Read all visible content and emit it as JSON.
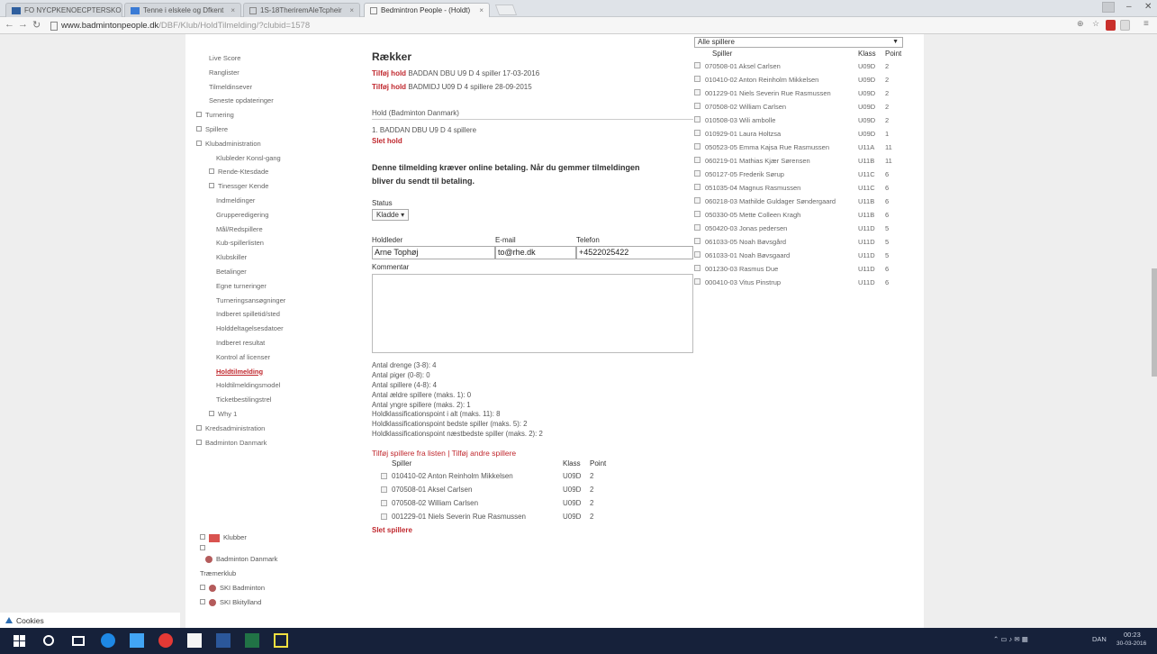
{
  "browser": {
    "tabs": [
      {
        "label": "FO NYCPKENOECPTERSKO"
      },
      {
        "label": "Tenne i elskele og Dfkent"
      },
      {
        "label": "1S-18TheriremAleTcpheir"
      },
      {
        "label": "Bedmintron People - (Holdt)"
      }
    ],
    "url_host": "www.badmintonpeople.dk",
    "url_path": "/DBF/Klub/HoldTilmelding/?clubid=1578"
  },
  "sidebar": {
    "items": [
      {
        "label": "Live Score",
        "level": 2
      },
      {
        "label": "Ranglister",
        "level": 2
      },
      {
        "label": "Tilmeldinsever",
        "level": 2
      },
      {
        "label": "Seneste opdateringer",
        "level": 2
      },
      {
        "label": "Turnering",
        "level": 1,
        "exp": true
      },
      {
        "label": "Spillere",
        "level": 1,
        "exp": true
      },
      {
        "label": "Klubadministration",
        "level": 1,
        "exp": true
      },
      {
        "label": "Klubleder Konsl-gang",
        "level": 3
      },
      {
        "label": "Rende-Ktesdade",
        "level": 2,
        "exp": true
      },
      {
        "label": "Tinessger Kende",
        "level": 2,
        "exp": true
      },
      {
        "label": "Indmeldinger",
        "level": 3
      },
      {
        "label": "Grupperedigering",
        "level": 3
      },
      {
        "label": "Mål/Redspillere",
        "level": 3
      },
      {
        "label": "Kub-spillerlisten",
        "level": 3
      },
      {
        "label": "Klubskiller",
        "level": 3
      },
      {
        "label": "Betalinger",
        "level": 3
      },
      {
        "label": "Egne turneringer",
        "level": 3
      },
      {
        "label": "Turneringsansøgninger",
        "level": 3
      },
      {
        "label": "Indberet spilletid/sted",
        "level": 3
      },
      {
        "label": "Holddeltagelsesdatoer",
        "level": 3
      },
      {
        "label": "Indberet resultat",
        "level": 3
      },
      {
        "label": "Kontrol af licenser",
        "level": 3
      },
      {
        "label": "Holdtilmelding",
        "level": 3,
        "active": true
      },
      {
        "label": "Holdtilmeldingsmodel",
        "level": 3
      },
      {
        "label": "Ticketbestilingstrel",
        "level": 3
      },
      {
        "label": "Why 1",
        "level": 2,
        "exp": true
      },
      {
        "label": "Kredsadministration",
        "level": 1,
        "exp": true
      },
      {
        "label": "Badminton Danmark",
        "level": 1,
        "exp": true
      }
    ],
    "klubber": {
      "title": "Klubber",
      "org": "Badminton Danmark",
      "kreds": "Træmerklub",
      "clubs": [
        "SKI Badminton",
        "SKI Bkitylland"
      ]
    }
  },
  "main": {
    "heading": "Rækker",
    "added": [
      {
        "prefix": "Tilføj hold",
        "text": "BADDAN DBU U9 D 4 spiller 17-03-2016"
      },
      {
        "prefix": "Tilføj hold",
        "text": "BADMIDJ U09 D 4 spillere      28-09-2015"
      }
    ],
    "hold_header": "Hold (Badminton Danmark)",
    "hold_line": "1. BADDAN DBU U9 D 4 spillere",
    "slet_hold": "Slet hold",
    "notice": "Denne tilmelding kræver online betaling. Når du gemmer tilmeldingen bliver du sendt til betaling.",
    "status_label": "Status",
    "status_value": "Kladde",
    "field_labels": {
      "holdleder": "Holdleder",
      "email": "E-mail",
      "telefon": "Telefon"
    },
    "fields": {
      "holdleder": "Arne Tophøj",
      "email": "to@rhe.dk",
      "telefon": "+4522025422"
    },
    "kommentar_label": "Kommentar",
    "stats": [
      "Antal drenge (3-8): 4",
      "Antal piger (0-8): 0",
      "Antal spillere (4-8): 4",
      "Antal ældre spillere (maks. 1): 0",
      "Antal yngre spillere (maks. 2): 1",
      "Holdklassificationspoint i alt (maks. 11): 8",
      "Holdklassificationspoint bedste spiller (maks. 5): 2",
      "Holdklassificationspoint næstbedste spiller (maks. 2): 2"
    ],
    "add_players": {
      "link1": "Tilføj spillere fra listen",
      "sep": " | ",
      "link2": "Tilføj andre spillere"
    },
    "player_cols": {
      "spiller": "Spiller",
      "klasse": "Klass",
      "point": "Point"
    },
    "players": [
      {
        "name": "010410-02 Anton Reinholm Mikkelsen",
        "klasse": "U09D",
        "point": "2"
      },
      {
        "name": "070508-01 Aksel Carlsen",
        "klasse": "U09D",
        "point": "2"
      },
      {
        "name": "070508-02 William Carlsen",
        "klasse": "U09D",
        "point": "2"
      },
      {
        "name": "001229-01 Niels Severin Rue Rasmussen",
        "klasse": "U09D",
        "point": "2"
      }
    ],
    "slet_spillere": "Slet spillere"
  },
  "right": {
    "filter": "Alle spillere",
    "cols": {
      "spiller": "Spiller",
      "klasse": "Klass",
      "point": "Point"
    },
    "rows": [
      {
        "name": "070508-01 Aksel Carlsen",
        "klasse": "U09D",
        "point": "2"
      },
      {
        "name": "010410-02 Anton Reinholm Mikkelsen",
        "klasse": "U09D",
        "point": "2"
      },
      {
        "name": "001229-01 Niels Severin Rue Rasmussen",
        "klasse": "U09D",
        "point": "2"
      },
      {
        "name": "070508-02 William Carlsen",
        "klasse": "U09D",
        "point": "2"
      },
      {
        "name": "010508-03 Wili ambolle",
        "klasse": "U09D",
        "point": "2"
      },
      {
        "name": "010929-01 Laura Holtzsa",
        "klasse": "U09D",
        "point": "1"
      },
      {
        "name": "050523-05 Emma Kajsa Rue Rasmussen",
        "klasse": "U11A",
        "point": "11"
      },
      {
        "name": "060219-01 Mathias Kjær Sørensen",
        "klasse": "U11B",
        "point": "11"
      },
      {
        "name": "050127-05 Frederik Sørup",
        "klasse": "U11C",
        "point": "6"
      },
      {
        "name": "051035-04 Magnus Rasmussen",
        "klasse": "U11C",
        "point": "6"
      },
      {
        "name": "060218-03 Mathilde Guldager Søndergaard",
        "klasse": "U11B",
        "point": "6"
      },
      {
        "name": "050330-05 Mette Colleen Kragh",
        "klasse": "U11B",
        "point": "6"
      },
      {
        "name": "050420-03 Jonas pedersen",
        "klasse": "U11D",
        "point": "5"
      },
      {
        "name": "061033-05 Noah Bøvsgård",
        "klasse": "U11D",
        "point": "5"
      },
      {
        "name": "061033-01 Noah Bøvsgaard",
        "klasse": "U11D",
        "point": "5"
      },
      {
        "name": "001230-03 Rasmus Due",
        "klasse": "U11D",
        "point": "6"
      },
      {
        "name": "000410-03 Vitus Pinstrup",
        "klasse": "U11D",
        "point": "6"
      }
    ]
  },
  "cookies": "Cookies",
  "taskbar": {
    "lang": "DAN",
    "time": "00:23",
    "date": "30-03-2016"
  },
  "colors": {
    "accent_red": "#c0282e",
    "taskbar": "#16213a"
  }
}
